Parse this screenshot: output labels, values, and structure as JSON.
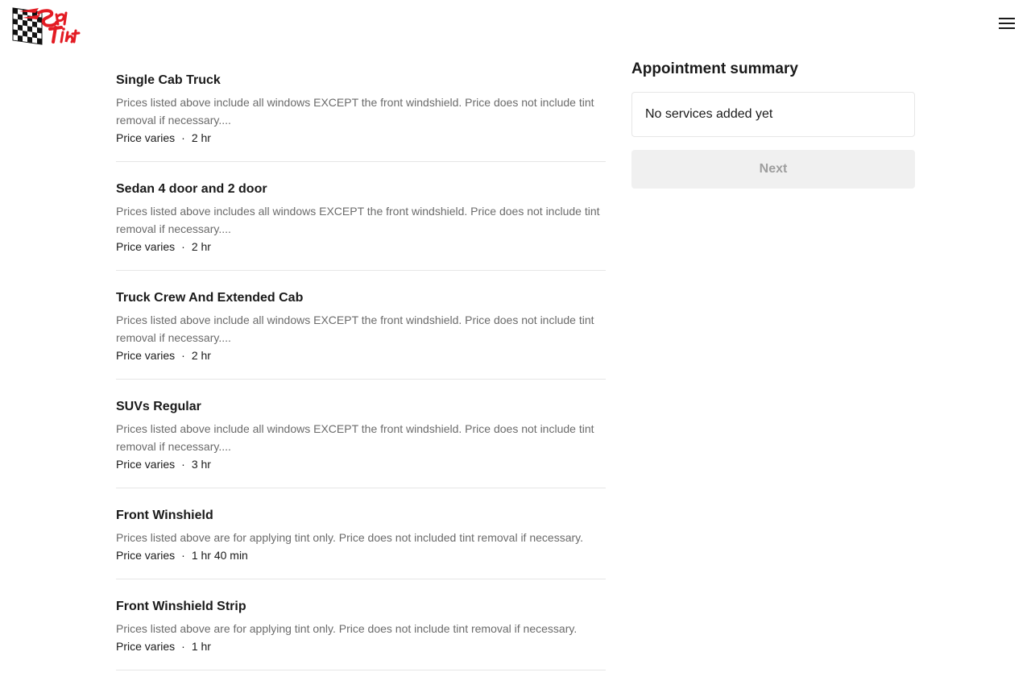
{
  "header": {
    "logo_text": "Spot Tint",
    "menu_icon": "hamburger-menu-icon"
  },
  "services": [
    {
      "title": "Single Cab Truck",
      "description": "Prices listed above include all windows EXCEPT the front windshield. Price does not include tint removal if necessary....",
      "price": "Price varies",
      "duration": "2 hr"
    },
    {
      "title": "Sedan 4 door and 2 door",
      "description": "Prices listed above includes all windows EXCEPT the front windshield. Price does not include tint removal if necessary....",
      "price": "Price varies",
      "duration": "2 hr"
    },
    {
      "title": "Truck Crew And Extended Cab",
      "description": "Prices listed above include all windows EXCEPT the front windshield. Price does not include tint removal if necessary....",
      "price": "Price varies",
      "duration": "2 hr"
    },
    {
      "title": "SUVs Regular",
      "description": "Prices listed above include all windows EXCEPT the front windshield. Price does not include tint removal if necessary....",
      "price": "Price varies",
      "duration": "3 hr"
    },
    {
      "title": "Front Winshield",
      "description": "Prices listed above are for applying tint only. Price does not included tint removal if necessary.",
      "price": "Price varies",
      "duration": "1 hr 40 min"
    },
    {
      "title": "Front Winshield Strip",
      "description": "Prices listed above are for applying tint only. Price does not include tint removal if necessary.",
      "price": "Price varies",
      "duration": "1 hr"
    }
  ],
  "summary": {
    "title": "Appointment summary",
    "empty_text": "No services added yet",
    "next_label": "Next"
  },
  "colors": {
    "logo_red": "#e31b23",
    "text": "#1a1a1a",
    "muted": "#6b6b6b",
    "disabled_bg": "#f0f0f0",
    "disabled_text": "#9e9e9e"
  }
}
